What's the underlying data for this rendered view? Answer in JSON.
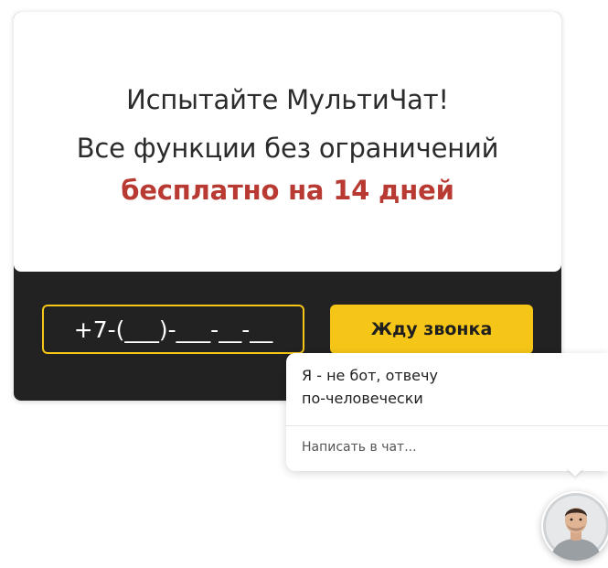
{
  "promo": {
    "headline_line1": "Испытайте МультиЧат!",
    "headline_line2": "Все функции без ограничений",
    "headline_line3": "бесплатно на 14 дней"
  },
  "callback_form": {
    "phone_value": "+7-(___)-___-__-__",
    "submit_label": "Жду звонка"
  },
  "chat_widget": {
    "message_line1": "Я - не бот, отвечу",
    "message_line2": "по-человечески",
    "reply_prompt": "Написать в чат...",
    "avatar_icon": "operator-avatar"
  },
  "colors": {
    "accent_red": "#b83a32",
    "accent_yellow": "#f5c518",
    "dark_panel": "#222222"
  }
}
